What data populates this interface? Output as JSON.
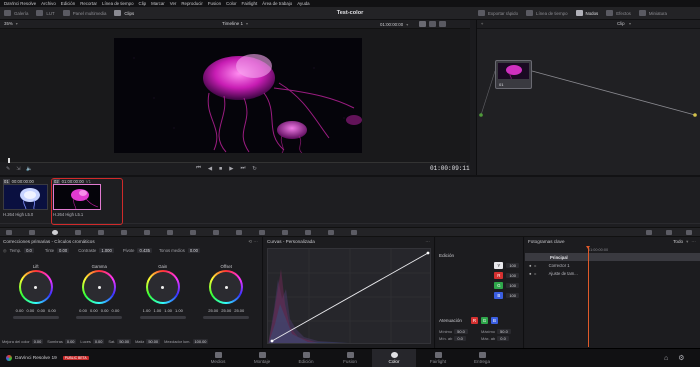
{
  "app": {
    "name": "DaVinci Resolve",
    "project_title": "Test-color"
  },
  "menu": [
    "DaVinci Resolve",
    "Archivo",
    "Edición",
    "Recortar",
    "Línea de tiempo",
    "Clip",
    "Marcar",
    "Ver",
    "Reproducir",
    "Fusion",
    "Color",
    "Fairlight",
    "Área de trabajo",
    "Ayuda"
  ],
  "toolbar": {
    "left": [
      "Galería",
      "LUT",
      "Panel multimedia",
      "Clips"
    ],
    "right": [
      "Exportar rápido",
      "Línea de tiempo",
      "Nodos",
      "Efectos",
      "Miniatura"
    ]
  },
  "viewer": {
    "zoom": "35%",
    "timeline_name": "Timeline 1",
    "timecode_top": "01:00:00:00",
    "timecode_current": "01:00:09:11"
  },
  "nodes": {
    "mode": "Clip",
    "node_label": "01"
  },
  "clips": [
    {
      "number": "01",
      "timecode": "00:00:00:00",
      "track": "V1",
      "codec": "H.264 High L5.0"
    },
    {
      "number": "02",
      "timecode": "01:00:00:00",
      "track": "V1",
      "codec": "H.264 High L5.1"
    }
  ],
  "primaries": {
    "title": "Correcciones primarias - Círculos cromáticos",
    "params": [
      {
        "label": "Temp.",
        "value": "0.0"
      },
      {
        "label": "Tinte",
        "value": "0.00"
      },
      {
        "label": "Contraste",
        "value": "1.000"
      },
      {
        "label": "Pivote",
        "value": "0.435"
      },
      {
        "label": "Tonos medios",
        "value": "0.00"
      }
    ],
    "wheels": [
      {
        "name": "Lift",
        "values": [
          "0.00",
          "0.00",
          "0.00",
          "0.00"
        ]
      },
      {
        "name": "Gamma",
        "values": [
          "0.00",
          "0.00",
          "0.00",
          "0.00"
        ]
      },
      {
        "name": "Gain",
        "values": [
          "1.00",
          "1.00",
          "1.00",
          "1.00"
        ]
      },
      {
        "name": "Offset",
        "values": [
          "25.00",
          "25.00",
          "25.00"
        ]
      }
    ],
    "bottom": [
      {
        "label": "Mejora del color",
        "value": "0.00"
      },
      {
        "label": "Sombras",
        "value": "0.00"
      },
      {
        "label": "Luces",
        "value": "0.00"
      },
      {
        "label": "Sat.",
        "value": "50.00"
      },
      {
        "label": "Matiz",
        "value": "50.00"
      },
      {
        "label": "Mezclador lum.",
        "value": "100.00"
      }
    ]
  },
  "curves": {
    "title": "Curvas - Personalizada"
  },
  "edit": {
    "title": "Edición",
    "channels": [
      {
        "label": "Y",
        "value": "100",
        "color": "#e8e8ec"
      },
      {
        "label": "R",
        "value": "100",
        "color": "#d43030"
      },
      {
        "label": "G",
        "value": "100",
        "color": "#2ea64a"
      },
      {
        "label": "B",
        "value": "100",
        "color": "#3a5ee0"
      }
    ],
    "softclip_title": "Atenuación",
    "softclip": [
      {
        "label": "Mínimo",
        "value": "50.0"
      },
      {
        "label": "Máximo",
        "value": "50.0"
      },
      {
        "label": "Mín. ab",
        "value": "0.0"
      },
      {
        "label": "Máx. ab",
        "value": "0.0"
      }
    ]
  },
  "keyframes": {
    "title": "Fotogramas clave",
    "filter": "Todo",
    "timecode": "01:00:00:00",
    "rows": [
      "Principal",
      "Corrector 1",
      "Ajuste de tam..."
    ]
  },
  "footer": {
    "app_label": "DaVinci Resolve 19",
    "badge": "PUBLIC BETA",
    "pages": [
      "Medios",
      "Montaje",
      "Edición",
      "Fusion",
      "Color",
      "Fairlight",
      "Entrega"
    ],
    "active_page": "Color"
  },
  "colors": {
    "accent_red": "#d02a2a",
    "active_page_bg": "#26262b",
    "playhead": "#e05a2a"
  }
}
